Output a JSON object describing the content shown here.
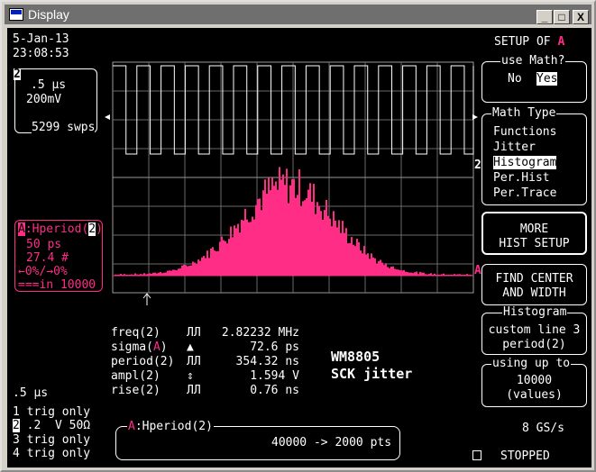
{
  "window": {
    "title": "Display",
    "min_label": "_",
    "max_label": "□",
    "close_label": "X"
  },
  "status": {
    "date": "5-Jan-13",
    "time": "23:08:53"
  },
  "timebase_box": {
    "channel": "2",
    "time_div": ".5 μs",
    "volt_div": "200mV",
    "sweeps": "5299 swps"
  },
  "math_box": {
    "trace_letter": "A",
    "label_suffix": ":Hperiod(",
    "label_channel": "2",
    "label_close": ")",
    "bin_width": "50 ps",
    "count": "27.4 #",
    "range": "←0%/→0%",
    "events": "===in 10000"
  },
  "left_time": ".5 μs",
  "channel_list": [
    {
      "num": "1",
      "text": "trig only"
    },
    {
      "num": "2",
      "text": ".2  V 50Ω",
      "highlight": true
    },
    {
      "num": "3",
      "text": "trig only"
    },
    {
      "num": "4",
      "text": "trig only"
    }
  ],
  "measurements": [
    {
      "name": "freq",
      "src": "2",
      "icon": "ЛЛ",
      "value": "2.82232 MHz"
    },
    {
      "name": "sigma",
      "src": "A",
      "icon": "▲",
      "value": "72.6 ps"
    },
    {
      "name": "period",
      "src": "2",
      "icon": "ЛЛ",
      "value": "354.32 ns"
    },
    {
      "name": "ampl",
      "src": "2",
      "icon": "⇕",
      "value": "1.594 V"
    },
    {
      "name": "rise",
      "src": "2",
      "icon": "ЛЛ",
      "value": "0.76 ns"
    }
  ],
  "annotation": {
    "line1": "WM8805",
    "line2": "SCK jitter"
  },
  "bottom_box": {
    "trace_letter": "A",
    "label": ":Hperiod(2)",
    "points": "40000 -> 2000 pts"
  },
  "sample_rate": "8 GS/s",
  "acq_status": "STOPPED",
  "trace_markers": {
    "ch2": "2",
    "mathA": "A"
  },
  "right_panel": {
    "setup_title": "SETUP OF",
    "setup_letter": "A",
    "use_math": {
      "title": "use Math?",
      "no": "No",
      "yes": "Yes"
    },
    "math_type": {
      "title": "Math Type",
      "items": [
        "Functions",
        "Jitter",
        "Histogram",
        "Per.Hist",
        "Per.Trace"
      ],
      "selected": "Histogram"
    },
    "more_hist": {
      "line1": "MORE",
      "line2": "HIST SETUP"
    },
    "find_center": {
      "line1": "FIND CENTER",
      "line2": "AND WIDTH"
    },
    "histogram": {
      "title": "Histogram",
      "line1": "custom line 3",
      "line2": "period(2)"
    },
    "using_up": {
      "title": "using up to",
      "line1": "10000",
      "line2": "(values)"
    }
  }
}
